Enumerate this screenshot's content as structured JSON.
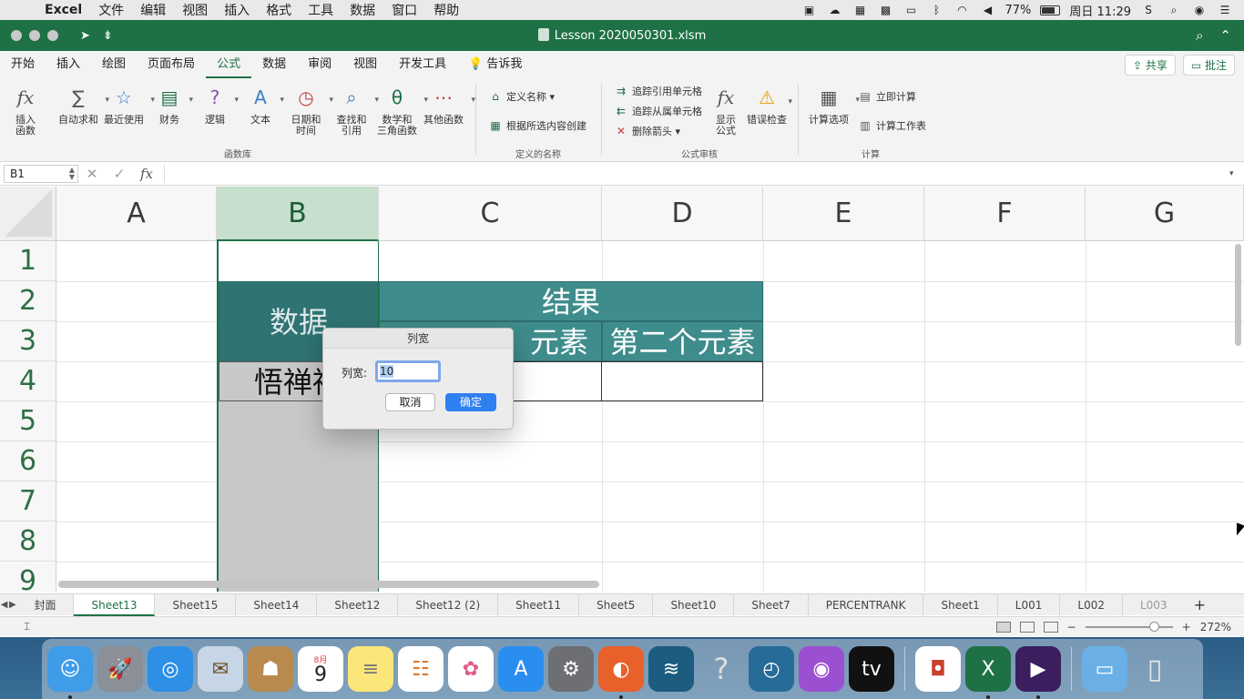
{
  "menubar": {
    "app": "Excel",
    "items": [
      "文件",
      "编辑",
      "视图",
      "插入",
      "格式",
      "工具",
      "数据",
      "窗口",
      "帮助"
    ],
    "battery": "77%",
    "clock": "周日 11:29"
  },
  "window": {
    "title": "Lesson 2020050301.xlsm"
  },
  "ribbon": {
    "tabs": [
      "开始",
      "插入",
      "绘图",
      "页面布局",
      "公式",
      "数据",
      "审阅",
      "视图",
      "开发工具"
    ],
    "active_tab": "公式",
    "tell_me": "告诉我",
    "share": "共享",
    "comments": "批注",
    "function_library": {
      "label": "函数库",
      "insert_function": "插入\n函数",
      "autosum": "自动求和",
      "recent": "最近使用",
      "financial": "财务",
      "logical": "逻辑",
      "text": "文本",
      "datetime": "日期和\n时间",
      "lookup": "查找和\n引用",
      "math": "数学和\n三角函数",
      "more": "其他函数"
    },
    "defined_names": {
      "label": "定义的名称",
      "define_name": "定义名称",
      "create_from_selection": "根据所选内容创建"
    },
    "auditing": {
      "label": "公式审核",
      "trace_precedents": "追踪引用单元格",
      "trace_dependents": "追踪从属单元格",
      "remove_arrows": "删除箭头",
      "show_formulas": "显示\n公式",
      "error_checking": "错误检查"
    },
    "calculation": {
      "label": "计算",
      "options": "计算选项",
      "calc_now": "立即计算",
      "calc_sheet": "计算工作表"
    }
  },
  "formula_bar": {
    "name_box": "B1",
    "fx": "fx",
    "value": ""
  },
  "grid": {
    "columns": [
      "A",
      "B",
      "C",
      "D",
      "E",
      "F",
      "G"
    ],
    "rows": [
      "1",
      "2",
      "3",
      "4",
      "5",
      "6",
      "7",
      "8",
      "9"
    ],
    "selected_column": "B",
    "cells": {
      "B2": "数据",
      "C2": "结果",
      "C3": "元素",
      "D3": "第二个元素",
      "B4": "悟禅禅"
    }
  },
  "dialog": {
    "title": "列宽",
    "label": "列宽:",
    "value": "10",
    "cancel": "取消",
    "ok": "确定"
  },
  "sheets": {
    "tabs": [
      "封面",
      "Sheet13",
      "Sheet15",
      "Sheet14",
      "Sheet12",
      "Sheet12 (2)",
      "Sheet11",
      "Sheet5",
      "Sheet10",
      "Sheet7",
      "PERCENTRANK",
      "Sheet1",
      "L001",
      "L002",
      "L003"
    ],
    "active": "Sheet13"
  },
  "status": {
    "zoom": "272%"
  },
  "dock": {
    "apps": [
      "finder",
      "launchpad",
      "safari",
      "mail",
      "contacts",
      "calendar",
      "notes",
      "reminders",
      "photos",
      "app-store",
      "system-preferences",
      "firefox",
      "mysql-workbench",
      "help",
      "time-machine",
      "podcasts",
      "apple-tv",
      "powerpoint",
      "excel",
      "video-app",
      "downloads",
      "trash"
    ],
    "calendar_month": "8月",
    "calendar_day": "9"
  }
}
